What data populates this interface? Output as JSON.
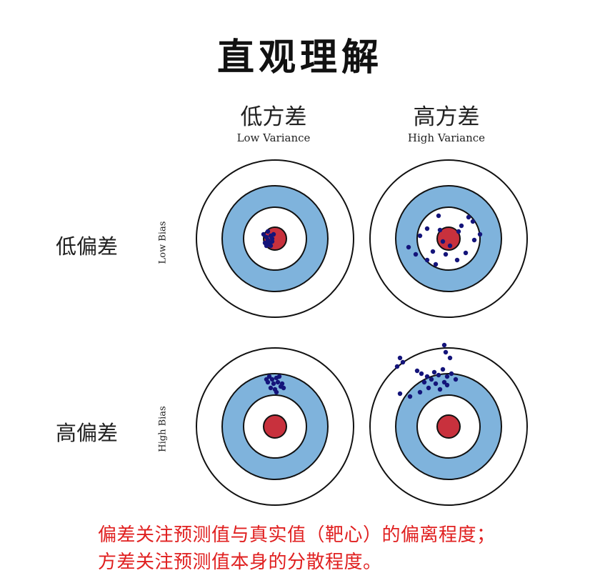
{
  "title": "直观理解",
  "columns": [
    {
      "zh": "低方差",
      "en": "Low Variance"
    },
    {
      "zh": "高方差",
      "en": "High Variance"
    }
  ],
  "rows": [
    {
      "zh": "低偏差",
      "en": "Low Bias"
    },
    {
      "zh": "高偏差",
      "en": "High Bias"
    }
  ],
  "colors": {
    "bullseye": "#c8313d",
    "blue_ring": "#7fb3dc",
    "ring_stroke": "#111111",
    "dots": "#14147a",
    "note": "#e02020"
  },
  "note_lines": [
    "偏差关注预测值与真实值（靶心）的偏离程度；",
    "方差关注预测值本身的分散程度。"
  ]
}
